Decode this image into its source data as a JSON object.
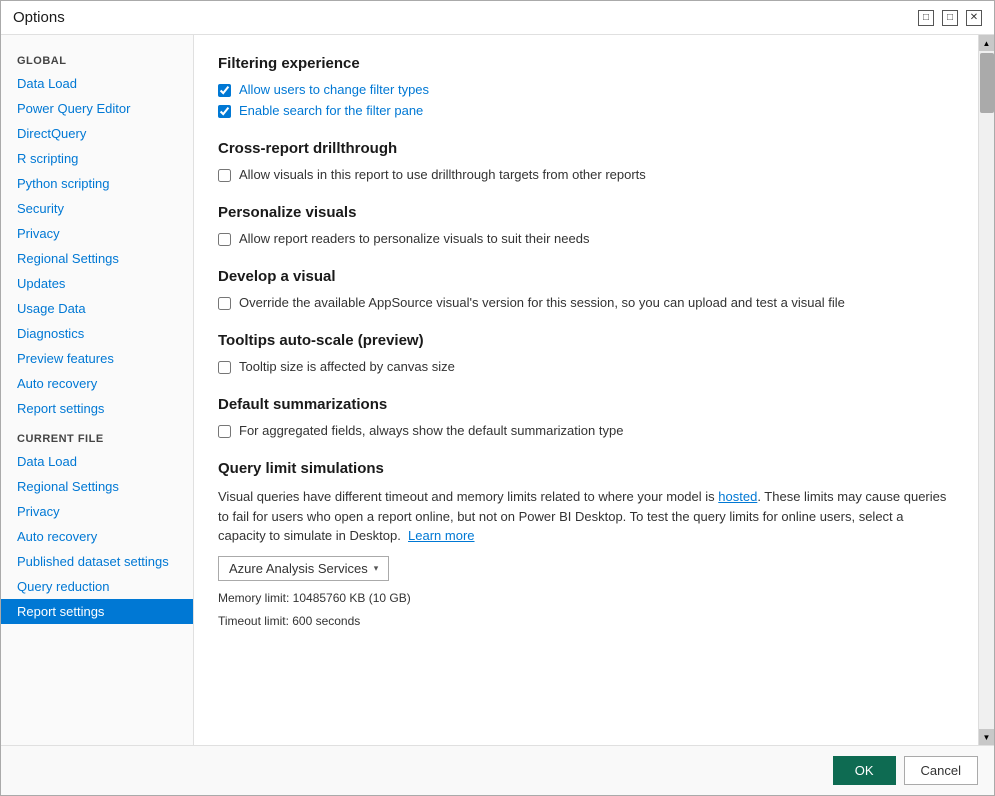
{
  "window": {
    "title": "Options",
    "minimize_label": "minimize",
    "maximize_label": "maximize",
    "close_label": "close"
  },
  "sidebar": {
    "global_label": "GLOBAL",
    "global_items": [
      {
        "id": "data-load",
        "label": "Data Load"
      },
      {
        "id": "power-query-editor",
        "label": "Power Query Editor"
      },
      {
        "id": "directquery",
        "label": "DirectQuery"
      },
      {
        "id": "r-scripting",
        "label": "R scripting"
      },
      {
        "id": "python-scripting",
        "label": "Python scripting"
      },
      {
        "id": "security",
        "label": "Security"
      },
      {
        "id": "privacy",
        "label": "Privacy"
      },
      {
        "id": "regional-settings",
        "label": "Regional Settings"
      },
      {
        "id": "updates",
        "label": "Updates"
      },
      {
        "id": "usage-data",
        "label": "Usage Data"
      },
      {
        "id": "diagnostics",
        "label": "Diagnostics"
      },
      {
        "id": "preview-features",
        "label": "Preview features"
      },
      {
        "id": "auto-recovery",
        "label": "Auto recovery"
      },
      {
        "id": "report-settings-global",
        "label": "Report settings"
      }
    ],
    "current_file_label": "CURRENT FILE",
    "current_file_items": [
      {
        "id": "cf-data-load",
        "label": "Data Load"
      },
      {
        "id": "cf-regional-settings",
        "label": "Regional Settings"
      },
      {
        "id": "cf-privacy",
        "label": "Privacy"
      },
      {
        "id": "cf-auto-recovery",
        "label": "Auto recovery"
      },
      {
        "id": "cf-published-dataset-settings",
        "label": "Published dataset settings"
      },
      {
        "id": "cf-query-reduction",
        "label": "Query reduction"
      },
      {
        "id": "cf-report-settings",
        "label": "Report settings",
        "active": true
      }
    ]
  },
  "main": {
    "sections": [
      {
        "id": "filtering-experience",
        "title": "Filtering experience",
        "checkboxes": [
          {
            "id": "allow-change-filter",
            "checked": true,
            "label": "Allow users to change filter types"
          },
          {
            "id": "enable-search-filter",
            "checked": true,
            "label": "Enable search for the filter pane"
          }
        ]
      },
      {
        "id": "cross-report-drillthrough",
        "title": "Cross-report drillthrough",
        "checkboxes": [
          {
            "id": "allow-visuals-drillthrough",
            "checked": false,
            "label": "Allow visuals in this report to use drillthrough targets from other reports"
          }
        ]
      },
      {
        "id": "personalize-visuals",
        "title": "Personalize visuals",
        "checkboxes": [
          {
            "id": "allow-personalize",
            "checked": false,
            "label": "Allow report readers to personalize visuals to suit their needs"
          }
        ]
      },
      {
        "id": "develop-visual",
        "title": "Develop a visual",
        "checkboxes": [
          {
            "id": "override-appsource",
            "checked": false,
            "label": "Override the available AppSource visual's version for this session, so you can upload and test a visual file"
          }
        ]
      },
      {
        "id": "tooltips-auto-scale",
        "title": "Tooltips auto-scale (preview)",
        "checkboxes": [
          {
            "id": "tooltip-canvas-size",
            "checked": false,
            "label": "Tooltip size is affected by canvas size"
          }
        ]
      },
      {
        "id": "default-summarizations",
        "title": "Default summarizations",
        "checkboxes": [
          {
            "id": "aggregated-fields",
            "checked": false,
            "label": "For aggregated fields, always show the default summarization type"
          }
        ]
      },
      {
        "id": "query-limit-simulations",
        "title": "Query limit simulations",
        "description": "Visual queries have different timeout and memory limits related to where your model is hosted. These limits may cause queries to fail for users who open a report online, but not on Power BI Desktop. To test the query limits for online users, select a capacity to simulate in Desktop.",
        "learn_more_label": "Learn more",
        "dropdown_value": "Azure Analysis Services",
        "memory_limit": "Memory limit: 10485760 KB (10 GB)",
        "timeout_limit": "Timeout limit: 600 seconds"
      }
    ]
  },
  "footer": {
    "ok_label": "OK",
    "cancel_label": "Cancel"
  }
}
